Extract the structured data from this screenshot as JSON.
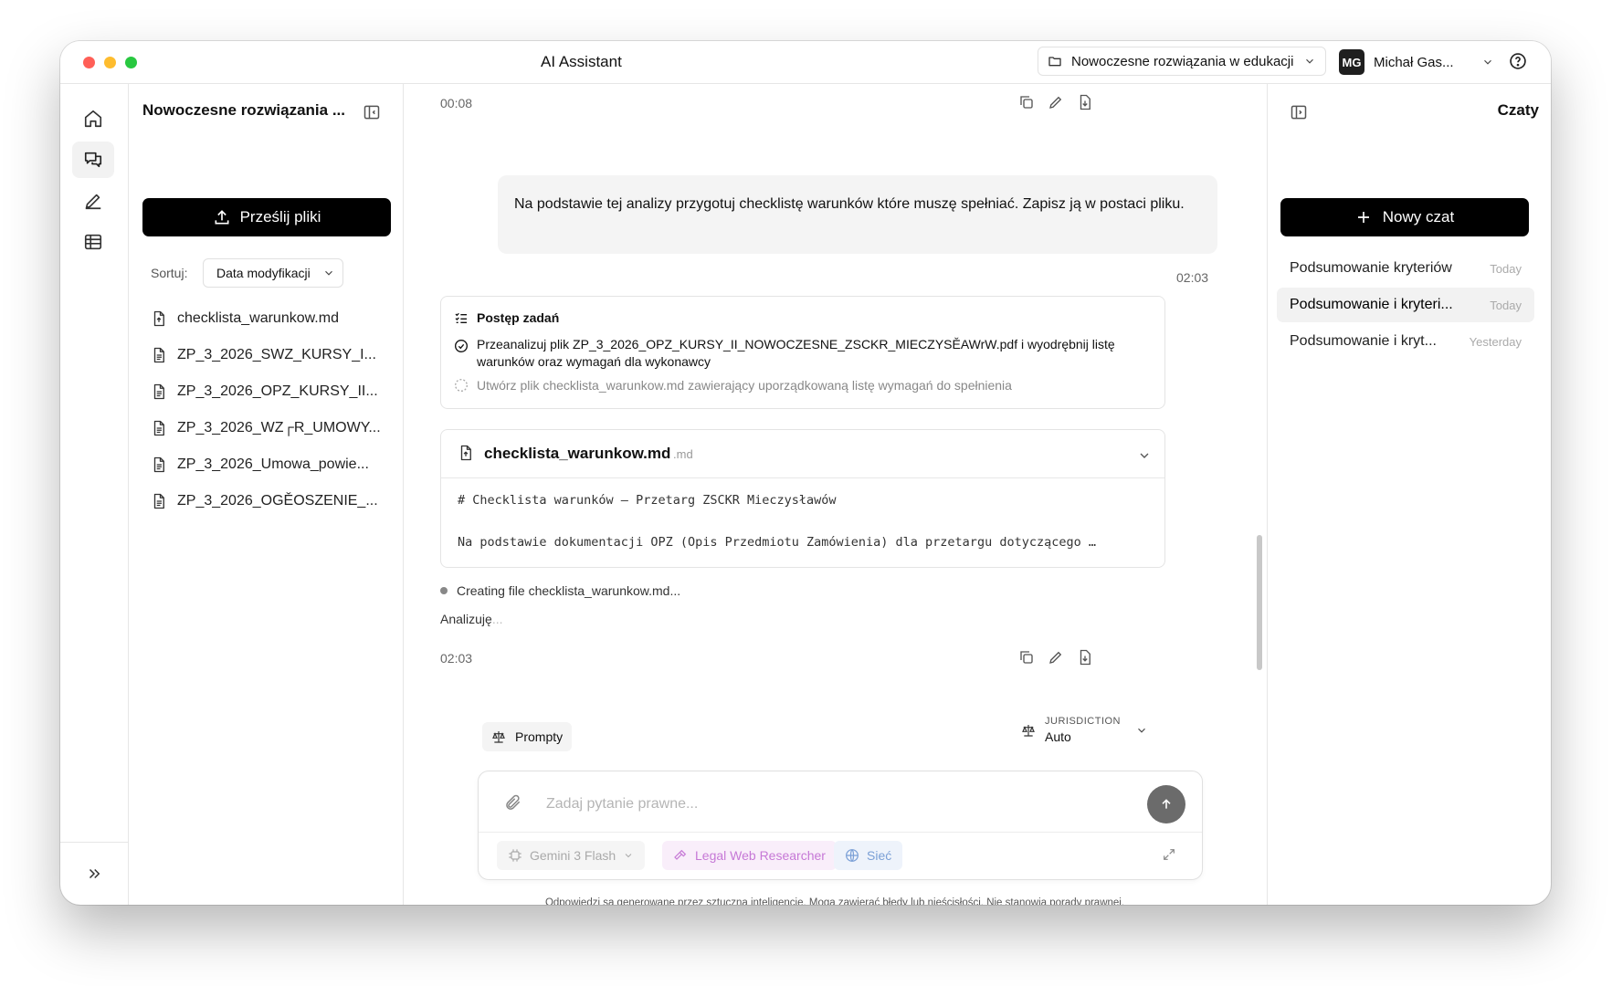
{
  "window": {
    "title": "AI Assistant",
    "project": "Nowoczesne rozwiązania w edukacji",
    "user": {
      "initials": "MG",
      "name": "Michał Gas..."
    }
  },
  "files_panel": {
    "title": "Nowoczesne rozwiązania ...",
    "upload_label": "Prześlij pliki",
    "sort_label": "Sortuj:",
    "sort_value": "Data modyfikacji",
    "files": [
      "checklista_warunkow.md",
      "ZP_3_2026_SWZ_KURSY_I...",
      "ZP_3_2026_OPZ_KURSY_II...",
      "ZP_3_2026_WZ┌R_UMOWY...",
      "ZP_3_2026_Umowa_powie...",
      "ZP_3_2026_OGĚOSZENIE_..."
    ]
  },
  "chat": {
    "time_top": "00:08",
    "user_message": "Na podstawie tej analizy przygotuj checklistę warunków które muszę spełniać. Zapisz ją w postaci pliku.",
    "user_message_time": "02:03",
    "tasks": {
      "title": "Postęp zadań",
      "items": [
        {
          "text": "Przeanalizuj plik ZP_3_2026_OPZ_KURSY_II_NOWOCZESNE_ZSCKR_MIECZYSĚAWrW.pdf i wyodrębnij listę warunków oraz wymagań dla wykonawcy",
          "status": "done"
        },
        {
          "text": "Utwórz plik checklista_warunkow.md zawierający uporządkowaną listę wymagań do spełnienia",
          "status": "pending"
        }
      ]
    },
    "file_card": {
      "name": "checklista_warunkow.md",
      "ext": ".md",
      "line1": "# Checklista warunków – Przetarg ZSCKR Mieczysławów",
      "line2": "Na podstawie dokumentacji OPZ (Opis Przedmiotu Zamówienia) dla przetargu dotyczącego …"
    },
    "status": "Creating file checklista_warunkow.md...",
    "analyzing": "Analizuję",
    "analyzing_dots": "...",
    "time_bottom": "02:03"
  },
  "composer": {
    "prompts_label": "Prompty",
    "jurisdiction_label": "JURISDICTION",
    "jurisdiction_value": "Auto",
    "placeholder": "Zadaj pytanie prawne...",
    "model": "Gemini 3 Flash",
    "tool_web": "Legal Web Researcher",
    "tool_net": "Sieć",
    "disclaimer": "Odpowiedzi są generowane przez sztuczną inteligencję. Mogą zawierać błędy lub nieścisłości. Nie stanowią porady prawnej."
  },
  "chats_panel": {
    "title": "Czaty",
    "new_chat": "Nowy czat",
    "items": [
      {
        "title": "Podsumowanie kryteriów",
        "date": "Today"
      },
      {
        "title": "Podsumowanie i kryteri...",
        "date": "Today"
      },
      {
        "title": "Podsumowanie i kryt...",
        "date": "Yesterday"
      }
    ]
  }
}
